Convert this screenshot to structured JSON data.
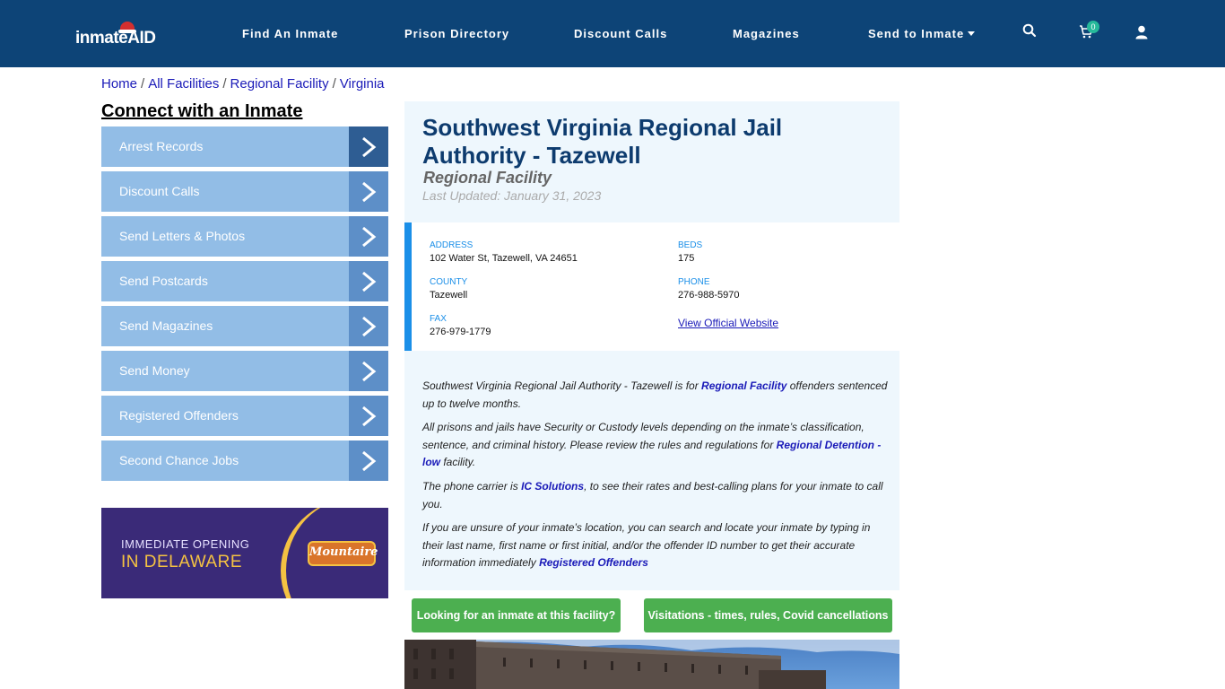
{
  "header": {
    "logo": "inmateAID",
    "nav": [
      "Find An Inmate",
      "Prison Directory",
      "Discount Calls",
      "Magazines",
      "Send to Inmate"
    ],
    "cart_count": "0",
    "bg_color": "#0d4477"
  },
  "breadcrumb": {
    "items": [
      "Home",
      "All Facilities",
      "Regional Facility",
      "Virginia"
    ],
    "separator": "/"
  },
  "sidebar": {
    "title": "Connect with an Inmate",
    "items": [
      {
        "label": "Arrest Records"
      },
      {
        "label": "Discount Calls"
      },
      {
        "label": "Send Letters & Photos"
      },
      {
        "label": "Send Postcards"
      },
      {
        "label": "Send Magazines"
      },
      {
        "label": "Send Money"
      },
      {
        "label": "Registered Offenders"
      },
      {
        "label": "Second Chance Jobs"
      }
    ]
  },
  "ad": {
    "line1": "IMMEDIATE OPENING",
    "line2": "IN DELAWARE",
    "brand": "Mountaire"
  },
  "facility": {
    "title": "Southwest Virginia Regional Jail Authority - Tazewell",
    "type": "Regional Facility",
    "last_updated": "Last Updated: January 31, 2023",
    "info": {
      "address_label": "ADDRESS",
      "address": "102 Water St, Tazewell, VA 24651",
      "beds_label": "BEDS",
      "beds": "175",
      "county_label": "COUNTY",
      "county": "Tazewell",
      "phone_label": "PHONE",
      "phone": "276-988-5970",
      "fax_label": "FAX",
      "fax": "276-979-1779",
      "website_link": "View Official Website"
    },
    "desc": {
      "p1_a": "Southwest Virginia Regional Jail Authority - Tazewell is for ",
      "p1_link": "Regional Facility",
      "p1_b": " offenders sentenced up to twelve months.",
      "p2_a": "All prisons and jails have Security or Custody levels depending on the inmate’s classification, sentence, and criminal history. Please review the rules and regulations for ",
      "p2_link": "Regional Detention - low",
      "p2_b": " facility.",
      "p3_a": "The phone carrier is ",
      "p3_link": "IC Solutions",
      "p3_b": ", to see their rates and best-calling plans for your inmate to call you.",
      "p4_a": "If you are unsure of your inmate’s location, you can search and locate your inmate by typing in their last name, first name or first initial, and/or the offender ID number to get their accurate information immediately ",
      "p4_link": "Registered Offenders"
    },
    "buttons": {
      "looking": "Looking for an inmate at this facility?",
      "visitations": "Visitations - times, rules, Covid cancellations"
    }
  },
  "colors": {
    "accent_blue": "#1b8fe8",
    "sidebar_button": "#92bde6",
    "green_button": "#4caf50",
    "title_blue": "#0d3b6e"
  }
}
